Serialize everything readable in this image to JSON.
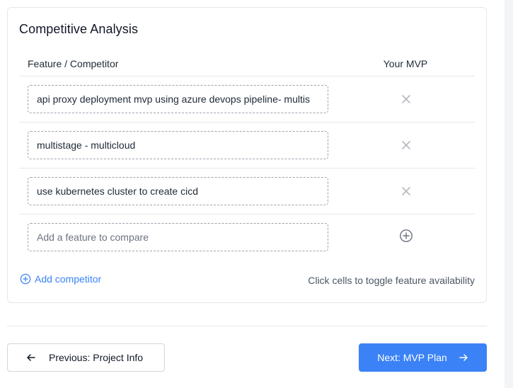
{
  "card": {
    "title": "Competitive Analysis",
    "columns": {
      "feature": "Feature / Competitor",
      "mvp": "Your MVP"
    },
    "features": [
      {
        "value": "api proxy deployment mvp using azure devops pipeline- multis",
        "mvp_icon": "close-icon"
      },
      {
        "value": "multistage - multicloud",
        "mvp_icon": "close-icon"
      },
      {
        "value": "use kubernetes cluster to create cicd",
        "mvp_icon": "close-icon"
      }
    ],
    "new_feature": {
      "value": "",
      "placeholder": "Add a feature to compare",
      "icon": "plus-circle-icon"
    },
    "add_competitor_label": "Add competitor",
    "hint": "Click cells to toggle feature availability"
  },
  "nav": {
    "prev_label": "Previous: Project Info",
    "next_label": "Next: MVP Plan"
  },
  "colors": {
    "accent": "#3b82f6",
    "icon_muted": "#b5b9bf",
    "border": "#e5e7eb"
  }
}
